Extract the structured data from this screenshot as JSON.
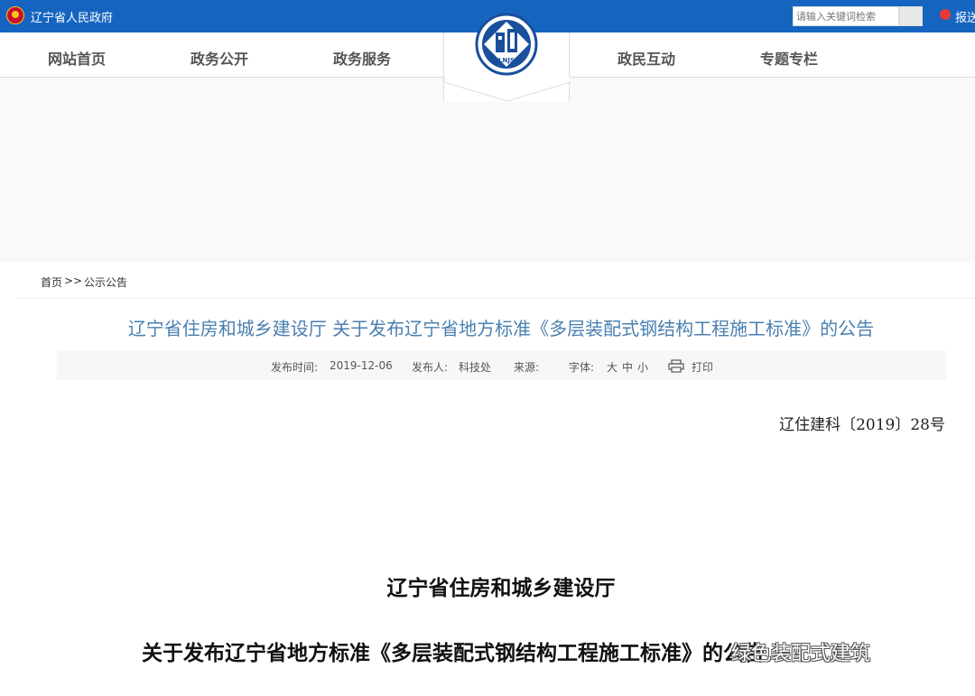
{
  "header": {
    "site_name": "辽宁省人民政府",
    "search_placeholder": "请输入关键词检索",
    "report_label": "报送"
  },
  "nav": {
    "items": [
      "网站首页",
      "政务公开",
      "政务服务",
      "政民互动",
      "专题专栏"
    ],
    "logo_text": "LNJS"
  },
  "breadcrumb": {
    "home": "首页",
    "sep": ">>",
    "current": "公示公告"
  },
  "article": {
    "title": "辽宁省住房和城乡建设厅 关于发布辽宁省地方标准《多层装配式钢结构工程施工标准》的公告",
    "meta": {
      "publish_time_label": "发布时间:",
      "publish_time": "2019-12-06",
      "publisher_label": "发布人:",
      "publisher": "科技处",
      "source_label": "来源:",
      "font_label": "字体:",
      "font_large": "大",
      "font_medium": "中",
      "font_small": "小",
      "print_label": "打印"
    },
    "doc_number": "辽住建科〔2019〕28号",
    "heading_1": "辽宁省住房和城乡建设厅",
    "heading_2": "关于发布辽宁省地方标准《多层装配式钢结构工程施工标准》的公告"
  },
  "watermark": "绿色装配式建筑",
  "colors": {
    "topbar": "#1565c0",
    "title": "#4a7fb0"
  }
}
